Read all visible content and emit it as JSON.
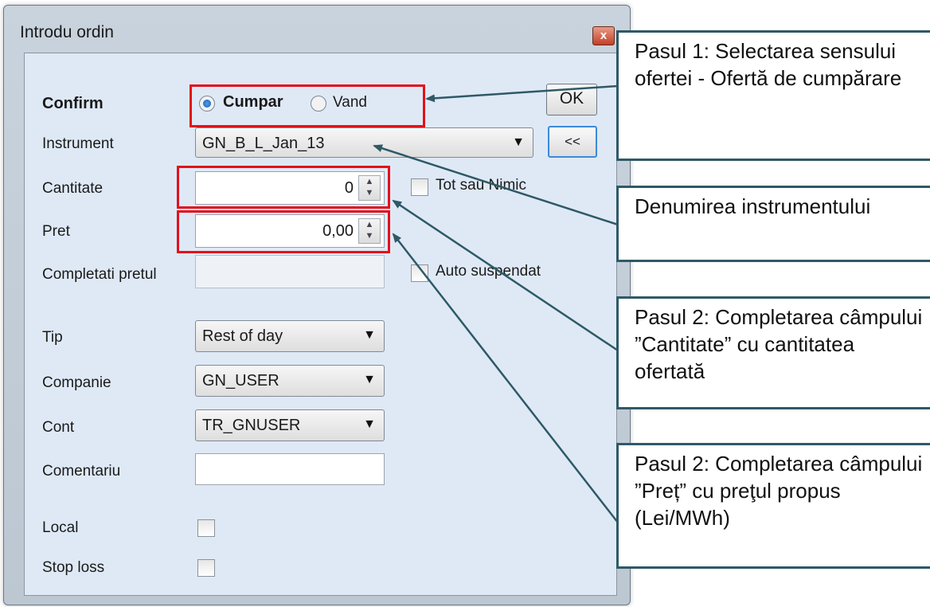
{
  "dialog": {
    "title": "Introdu ordin",
    "close_label": "x",
    "ok_label": "OK",
    "collapse_label": "<<"
  },
  "form": {
    "confirm_label": "Confirm",
    "side_buy": "Cumpar",
    "side_sell": "Vand",
    "selected_side": "Cumpar",
    "instrument_label": "Instrument",
    "instrument_value": "GN_B_L_Jan_13",
    "quantity_label": "Cantitate",
    "quantity_value": "0",
    "all_or_none_label": "Tot sau Nimic",
    "price_label": "Pret",
    "price_value": "0,00",
    "complete_price_label": "Completati pretul",
    "auto_suspend_label": "Auto suspendat",
    "type_label": "Tip",
    "type_value": "Rest of day",
    "company_label": "Companie",
    "company_value": "GN_USER",
    "account_label": "Cont",
    "account_value": "TR_GNUSER",
    "comment_label": "Comentariu",
    "comment_value": "",
    "local_label": "Local",
    "stop_loss_label": "Stop loss"
  },
  "annotations": {
    "step1": "Pasul 1: Selectarea sensului ofertei - Ofertă de cumpărare",
    "instrument_name": "Denumirea instrumentului",
    "step2_quantity": "Pasul 2: Completarea câmpului ”Cantitate” cu cantitatea ofertată",
    "step2_price": "Pasul 2: Completarea câmpului ”Preț” cu preţul propus (Lei/MWh)"
  },
  "colors": {
    "highlight": "#e3101b",
    "callout_border": "#2f5966",
    "client_background": "#dfe9f6"
  }
}
